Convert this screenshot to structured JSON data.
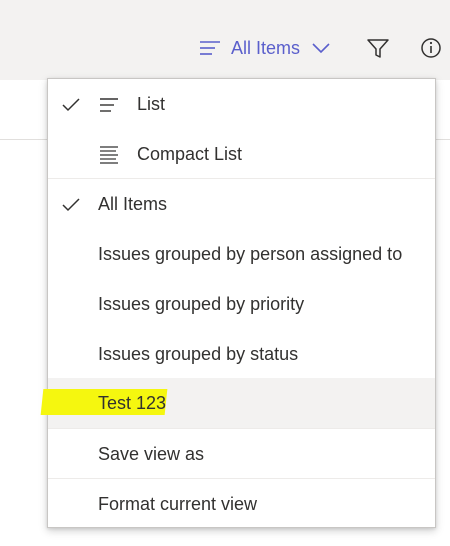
{
  "command_bar": {
    "view_label": "All Items",
    "icons": [
      "view-lines-icon",
      "chevron-down-icon",
      "filter-icon",
      "info-icon"
    ]
  },
  "menu": {
    "layout_items": [
      {
        "label": "List",
        "checked": true,
        "icon": "list-lines-icon"
      },
      {
        "label": "Compact List",
        "checked": false,
        "icon": "compact-list-icon"
      }
    ],
    "views": [
      {
        "label": "All Items",
        "checked": true
      },
      {
        "label": "Issues grouped by person assigned to",
        "checked": false
      },
      {
        "label": "Issues grouped by priority",
        "checked": false
      },
      {
        "label": "Issues grouped by status",
        "checked": false
      },
      {
        "label": "Test 123",
        "checked": false,
        "hovered": true,
        "highlighted": true
      }
    ],
    "actions": [
      {
        "label": "Save view as"
      },
      {
        "label": "Format current view"
      }
    ]
  },
  "colors": {
    "accent": "#5a5fcc",
    "command_bar_bg": "#f3f2f1",
    "hover_bg": "#f3f2f1",
    "highlight": "#f5f70f",
    "text": "#323130"
  }
}
